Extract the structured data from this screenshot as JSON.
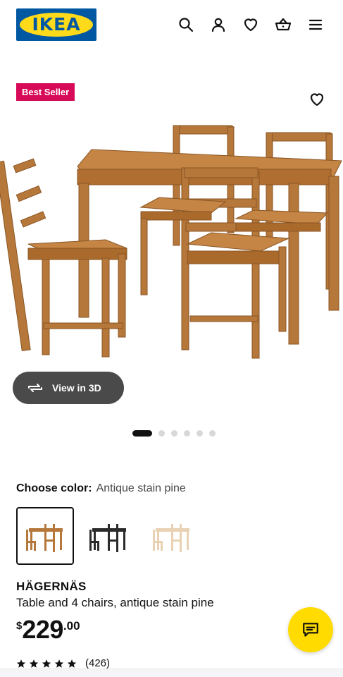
{
  "header": {
    "logo_text": "IKEA",
    "icons": [
      "search-icon",
      "user-icon",
      "heart-icon",
      "basket-icon",
      "menu-icon"
    ]
  },
  "product_media": {
    "badge": "Best Seller",
    "view3d_label": "View in 3D",
    "carousel": {
      "total": 6,
      "active": 1
    }
  },
  "color_selector": {
    "label": "Choose color:",
    "value": "Antique stain pine",
    "swatches": [
      {
        "name": "Antique stain pine",
        "color": "#b5773a",
        "selected": true
      },
      {
        "name": "black-brown",
        "color": "#2b2b2b",
        "selected": false
      },
      {
        "name": "white stain",
        "color": "#e9d2b4",
        "selected": false
      }
    ]
  },
  "product": {
    "name": "HÄGERNÄS",
    "description": "Table and 4 chairs, antique stain pine",
    "price_currency": "$",
    "price_integer": "229",
    "price_decimal": ".00",
    "rating_stars": 5,
    "review_count": "(426)"
  },
  "colors": {
    "ikea_blue": "#0058a3",
    "ikea_yellow": "#ffda1a",
    "badge_red": "#d70a57",
    "chat_yellow": "#ffdb00",
    "wood": "#b5773a"
  }
}
